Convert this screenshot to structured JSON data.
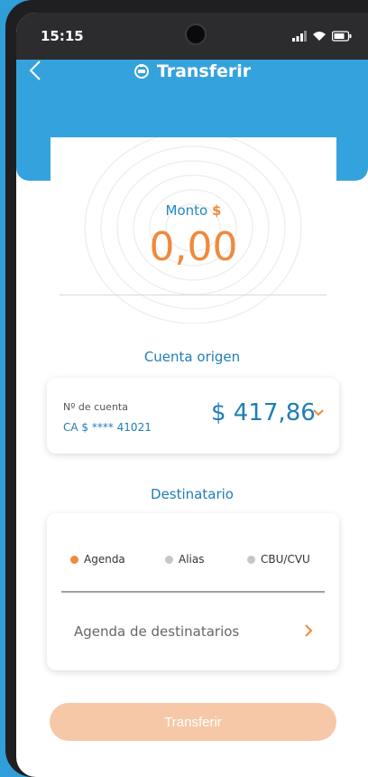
{
  "status_bar": {
    "time": "15:15"
  },
  "header": {
    "title": "Transferir",
    "back_icon": "chevron-left-icon",
    "title_icon": "transfer-icon"
  },
  "amount": {
    "label": "Monto",
    "currency_symbol": "$",
    "value": "0,00"
  },
  "origin_section": {
    "title": "Cuenta origen",
    "account_label": "Nº de cuenta",
    "account_number": "CA $ **** 41021",
    "balance": "$ 417,86"
  },
  "destination_section": {
    "title": "Destinatario",
    "options": [
      "Agenda",
      "Alias",
      "CBU/CVU"
    ],
    "selected": "Agenda",
    "agenda_label": "Agenda de destinatarios"
  },
  "transfer_button": {
    "label": "Transferir"
  },
  "colors": {
    "header_blue": "#34a2dd",
    "accent_orange": "#f08a3c",
    "text_blue": "#1f7db8",
    "button_disabled": "#f6c8a8"
  }
}
